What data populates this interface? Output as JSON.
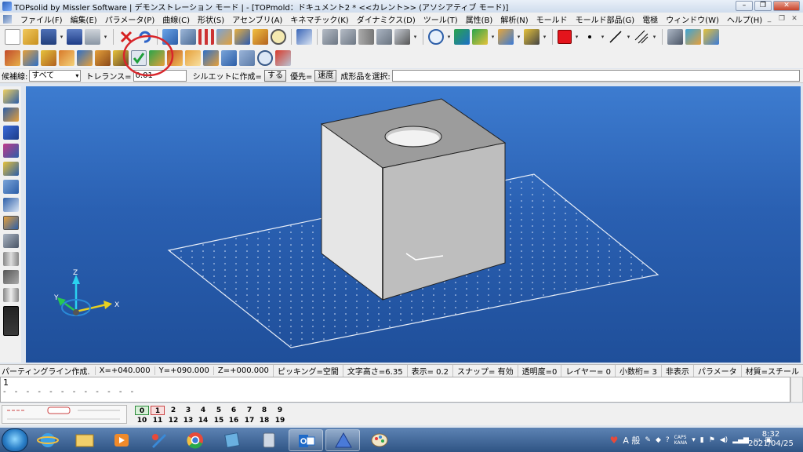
{
  "window": {
    "title": "TOPsolid by Missler Software | デモンストレーション モード | - [TOPmold：ドキュメント2 *  <<カレント>> (アソシアティブ モード)]"
  },
  "menu": [
    "ファイル(F)",
    "編集(E)",
    "パラメータ(P)",
    "曲線(C)",
    "形状(S)",
    "アセンブリ(A)",
    "キネマチック(K)",
    "ダイナミクス(D)",
    "ツール(T)",
    "属性(B)",
    "解析(N)",
    "モールド",
    "モールド部品(G)",
    "電極",
    "ウィンドウ(W)",
    "ヘルプ(H)"
  ],
  "options_bar": {
    "candidate_label": "候補線:",
    "candidate_value": "すべて",
    "tolerance_label": "トレランス=",
    "tolerance_value": "0.01",
    "silhouette_label": "シルエットに作成=",
    "silhouette_button": "する",
    "priority_label": "優先=",
    "priority_button": "速度",
    "select_label": "成形品を選択:"
  },
  "viewport": {
    "axes": {
      "x": "X",
      "y": "Y",
      "z": "Z"
    },
    "annotation_circle_color": "#d8262b"
  },
  "status": {
    "message": "パーティングライン作成.",
    "items": [
      "X=+040.000",
      "Y=+090.000",
      "Z=+000.000",
      "ピッキング=空間",
      "文字高さ=6.35",
      "表示=  0.2",
      "スナップ= 有効",
      "透明度=0",
      "レイヤー=  0",
      "小数桁= 3",
      "非表示",
      "パラメータ",
      "材質=スチール"
    ]
  },
  "command": {
    "line1": "1",
    "line2": "- - - - - - - - - - - -"
  },
  "layers": {
    "row1": [
      "0",
      "1",
      "2",
      "3",
      "4",
      "5",
      "6",
      "7",
      "8",
      "9"
    ],
    "row2": [
      "10",
      "11",
      "12",
      "13",
      "14",
      "15",
      "16",
      "17",
      "18",
      "19"
    ]
  },
  "clock": {
    "time": "8:32",
    "date": "2021/04/25"
  },
  "tray": {
    "ime": "A 般",
    "caps": "CAPS",
    "kana": "KANA"
  }
}
